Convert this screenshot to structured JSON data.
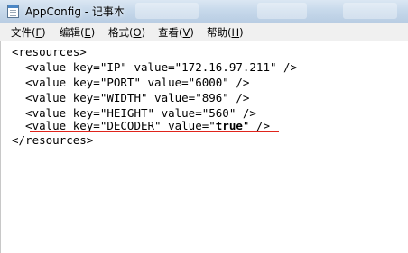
{
  "window": {
    "title": "AppConfig - 记事本",
    "icon": "notepad-icon"
  },
  "menu": {
    "items": [
      {
        "label": "文件(",
        "accel": "F",
        "close": ")"
      },
      {
        "label": "编辑(",
        "accel": "E",
        "close": ")"
      },
      {
        "label": "格式(",
        "accel": "O",
        "close": ")"
      },
      {
        "label": "查看(",
        "accel": "V",
        "close": ")"
      },
      {
        "label": "帮助(",
        "accel": "H",
        "close": ")"
      }
    ]
  },
  "document": {
    "lines": [
      {
        "text": "<resources>"
      },
      {
        "text": "  <value key=\"IP\" value=\"172.16.97.211\" />"
      },
      {
        "text": "  <value key=\"PORT\" value=\"6000\" />"
      },
      {
        "text": "  <value key=\"WIDTH\" value=\"896\" />"
      },
      {
        "text": "  <value key=\"HEIGHT\" value=\"560\" />"
      },
      {
        "pre": "  <value key=\"DECODER\" value=\"",
        "bold": "true",
        "post": "\" />"
      },
      {
        "text": "</resources>"
      }
    ],
    "highlight_color": "#e0241c"
  }
}
